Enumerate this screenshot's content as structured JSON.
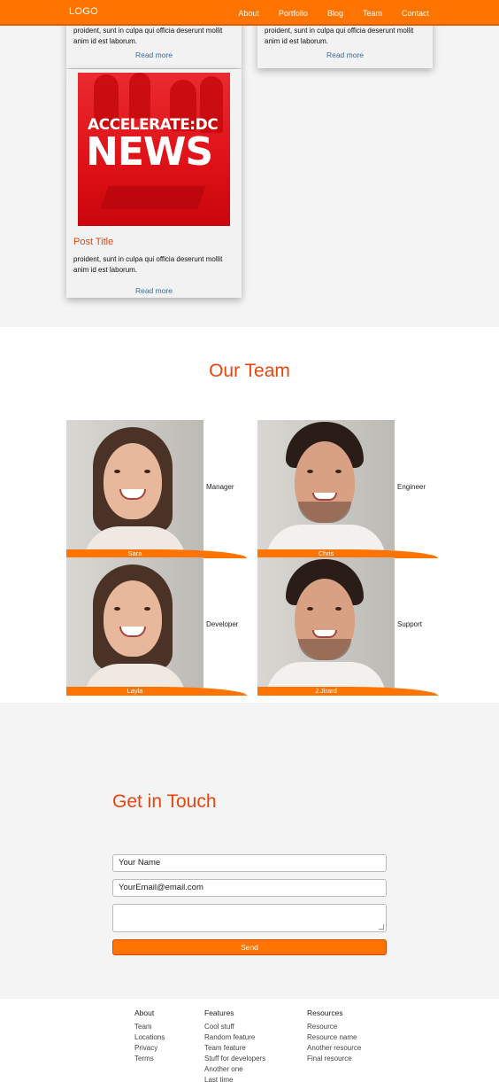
{
  "nav": {
    "logo": "LOGO",
    "links": [
      "About",
      "Portfolio",
      "Blog",
      "Team",
      "Contact"
    ]
  },
  "blog": {
    "cards_top": [
      {
        "excerpt": "proident, sunt in culpa qui officia deserunt mollit anim id est laborum.",
        "read_more": "Read more"
      },
      {
        "excerpt": "proident, sunt in culpa qui officia deserunt mollit anim id est laborum.",
        "read_more": "Read more"
      }
    ],
    "post": {
      "image_text_line1": "ACCELERATE:DC",
      "image_text_line2": "NEWS",
      "title": "Post Title",
      "excerpt": "proident, sunt in culpa qui officia deserunt mollit anim id est laborum.",
      "read_more": "Read more"
    }
  },
  "team": {
    "heading": "Our Team",
    "members": [
      {
        "name": "Sara",
        "role": "Manager"
      },
      {
        "name": "Chris",
        "role": "Engineer"
      },
      {
        "name": "Layla",
        "role": "Developer"
      },
      {
        "name": "J.Jirard",
        "role": "Support"
      }
    ]
  },
  "contact": {
    "heading": "Get in Touch",
    "name_value": "Your Name",
    "email_value": "YourEmail@email.com",
    "message_value": "",
    "send_label": "Send"
  },
  "footer": {
    "columns": [
      {
        "heading": "About",
        "items": [
          "Team",
          "Locations",
          "Privacy",
          "Terms"
        ]
      },
      {
        "heading": "Features",
        "items": [
          "Cool stuff",
          "Random feature",
          "Team feature",
          "Stuff for developers",
          "Another one",
          "Last time"
        ]
      },
      {
        "heading": "Resources",
        "items": [
          "Resource",
          "Resource name",
          "Another resource",
          "Final resource"
        ]
      }
    ]
  },
  "colors": {
    "accent": "#ff7300",
    "heading": "#e8440f",
    "link": "#3b6aa5"
  }
}
